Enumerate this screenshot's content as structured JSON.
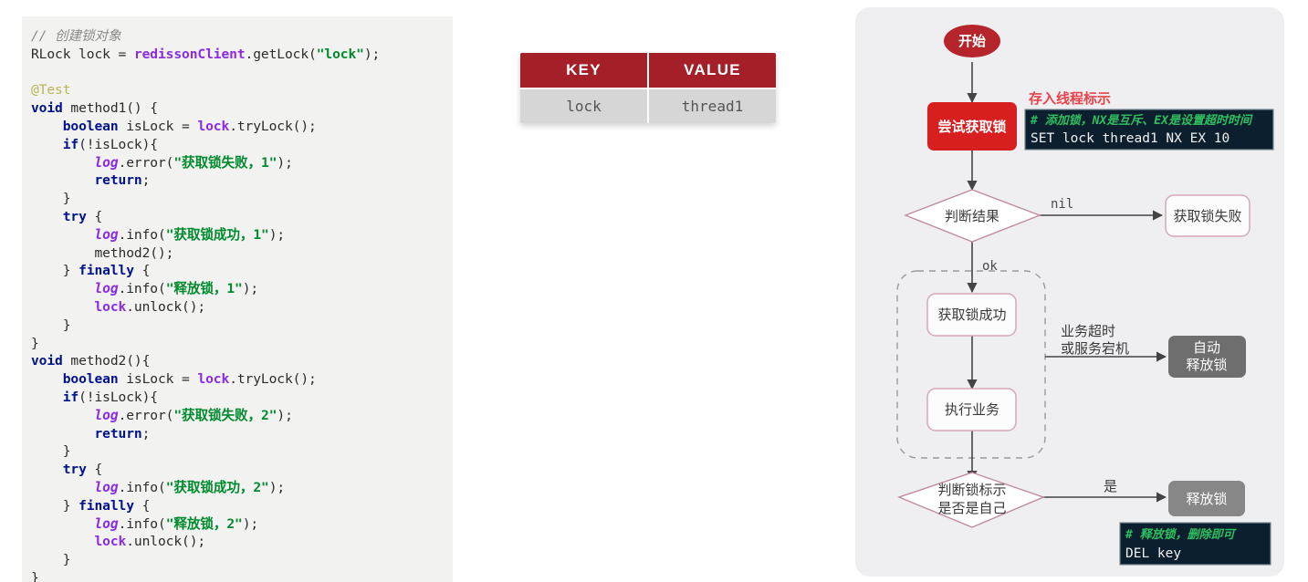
{
  "code_panel": {
    "language": "java",
    "lines": [
      [
        {
          "t": "// 创建锁对象",
          "c": "cm"
        }
      ],
      [
        {
          "t": "RLock lock = ",
          "c": "pl"
        },
        {
          "t": "redissonClient",
          "c": "fn"
        },
        {
          "t": ".getLock(",
          "c": "pl"
        },
        {
          "t": "\"lock\"",
          "c": "st"
        },
        {
          "t": ");",
          "c": "pl"
        }
      ],
      [],
      [
        {
          "t": "@Test",
          "c": "ann"
        }
      ],
      [
        {
          "t": "void",
          "c": "kw"
        },
        {
          "t": " method1() {",
          "c": "pl"
        }
      ],
      [
        {
          "t": "    ",
          "c": "pl"
        },
        {
          "t": "boolean",
          "c": "kw"
        },
        {
          "t": " isLock = ",
          "c": "pl"
        },
        {
          "t": "lock",
          "c": "fn"
        },
        {
          "t": ".tryLock();",
          "c": "pl"
        }
      ],
      [
        {
          "t": "    ",
          "c": "pl"
        },
        {
          "t": "if",
          "c": "kw"
        },
        {
          "t": "(!isLock){",
          "c": "pl"
        }
      ],
      [
        {
          "t": "        ",
          "c": "pl"
        },
        {
          "t": "log",
          "c": "lg"
        },
        {
          "t": ".error(",
          "c": "pl"
        },
        {
          "t": "\"获取锁失败，1\"",
          "c": "st"
        },
        {
          "t": ");",
          "c": "pl"
        }
      ],
      [
        {
          "t": "        ",
          "c": "pl"
        },
        {
          "t": "return",
          "c": "kw"
        },
        {
          "t": ";",
          "c": "pl"
        }
      ],
      [
        {
          "t": "    }",
          "c": "pl"
        }
      ],
      [
        {
          "t": "    ",
          "c": "pl"
        },
        {
          "t": "try",
          "c": "kw"
        },
        {
          "t": " {",
          "c": "pl"
        }
      ],
      [
        {
          "t": "        ",
          "c": "pl"
        },
        {
          "t": "log",
          "c": "lg"
        },
        {
          "t": ".info(",
          "c": "pl"
        },
        {
          "t": "\"获取锁成功，1\"",
          "c": "st"
        },
        {
          "t": ");",
          "c": "pl"
        }
      ],
      [
        {
          "t": "        method2();",
          "c": "pl"
        }
      ],
      [
        {
          "t": "    } ",
          "c": "pl"
        },
        {
          "t": "finally",
          "c": "kw"
        },
        {
          "t": " {",
          "c": "pl"
        }
      ],
      [
        {
          "t": "        ",
          "c": "pl"
        },
        {
          "t": "log",
          "c": "lg"
        },
        {
          "t": ".info(",
          "c": "pl"
        },
        {
          "t": "\"释放锁，1\"",
          "c": "st"
        },
        {
          "t": ");",
          "c": "pl"
        }
      ],
      [
        {
          "t": "        ",
          "c": "pl"
        },
        {
          "t": "lock",
          "c": "fn"
        },
        {
          "t": ".unlock();",
          "c": "pl"
        }
      ],
      [
        {
          "t": "    }",
          "c": "pl"
        }
      ],
      [
        {
          "t": "}",
          "c": "pl"
        }
      ],
      [
        {
          "t": "void",
          "c": "kw"
        },
        {
          "t": " method2(){",
          "c": "pl"
        }
      ],
      [
        {
          "t": "    ",
          "c": "pl"
        },
        {
          "t": "boolean",
          "c": "kw"
        },
        {
          "t": " isLock = ",
          "c": "pl"
        },
        {
          "t": "lock",
          "c": "fn"
        },
        {
          "t": ".tryLock();",
          "c": "pl"
        }
      ],
      [
        {
          "t": "    ",
          "c": "pl"
        },
        {
          "t": "if",
          "c": "kw"
        },
        {
          "t": "(!isLock){",
          "c": "pl"
        }
      ],
      [
        {
          "t": "        ",
          "c": "pl"
        },
        {
          "t": "log",
          "c": "lg"
        },
        {
          "t": ".error(",
          "c": "pl"
        },
        {
          "t": "\"获取锁失败，2\"",
          "c": "st"
        },
        {
          "t": ");",
          "c": "pl"
        }
      ],
      [
        {
          "t": "        ",
          "c": "pl"
        },
        {
          "t": "return",
          "c": "kw"
        },
        {
          "t": ";",
          "c": "pl"
        }
      ],
      [
        {
          "t": "    }",
          "c": "pl"
        }
      ],
      [
        {
          "t": "    ",
          "c": "pl"
        },
        {
          "t": "try",
          "c": "kw"
        },
        {
          "t": " {",
          "c": "pl"
        }
      ],
      [
        {
          "t": "        ",
          "c": "pl"
        },
        {
          "t": "log",
          "c": "lg"
        },
        {
          "t": ".info(",
          "c": "pl"
        },
        {
          "t": "\"获取锁成功，2\"",
          "c": "st"
        },
        {
          "t": ");",
          "c": "pl"
        }
      ],
      [
        {
          "t": "    } ",
          "c": "pl"
        },
        {
          "t": "finally",
          "c": "kw"
        },
        {
          "t": " {",
          "c": "pl"
        }
      ],
      [
        {
          "t": "        ",
          "c": "pl"
        },
        {
          "t": "log",
          "c": "lg"
        },
        {
          "t": ".info(",
          "c": "pl"
        },
        {
          "t": "\"释放锁，2\"",
          "c": "st"
        },
        {
          "t": ");",
          "c": "pl"
        }
      ],
      [
        {
          "t": "        ",
          "c": "pl"
        },
        {
          "t": "lock",
          "c": "fn"
        },
        {
          "t": ".unlock();",
          "c": "pl"
        }
      ],
      [
        {
          "t": "    }",
          "c": "pl"
        }
      ],
      [
        {
          "t": "}",
          "c": "pl"
        }
      ]
    ]
  },
  "kv_table": {
    "headers": [
      "KEY",
      "VALUE"
    ],
    "rows": [
      [
        "lock",
        "thread1"
      ]
    ],
    "header_bg": "#a41f28",
    "row_bg": "#d6d6d6"
  },
  "flowchart": {
    "nodes": {
      "start": "开始",
      "try_acquire": "尝试获取锁",
      "judge_result": "判断结果",
      "acquire_fail": "获取锁失败",
      "acquire_success": "获取锁成功",
      "do_business": "执行业务",
      "auto_release": [
        "自动",
        "释放锁"
      ],
      "judge_owner": [
        "判断锁标示",
        "是否是自己"
      ],
      "release_lock": "释放锁"
    },
    "edge_labels": {
      "nil": "nil",
      "ok": "ok",
      "timeout": [
        "业务超时",
        "或服务宕机"
      ],
      "yes": "是"
    },
    "annotations": {
      "store_thread_flag": "存入线程标示"
    },
    "terminals": [
      {
        "comment": "#  添加锁，NX是互斥、EX是设置超时时间",
        "command": "SET lock thread1 NX EX 10"
      },
      {
        "comment": "#  释放锁，删除即可",
        "command": "DEL key"
      }
    ],
    "colors": {
      "start_fill": "#b5252b",
      "action_fill": "#d81f20",
      "node_border": "#d7a6b9",
      "gray_fill": "#6e6e6e",
      "annotation_text": "#e8434a",
      "terminal_bg": "#0c1f2f",
      "terminal_comment": "#2fbf5f",
      "panel_bg": "#efeef0"
    }
  }
}
